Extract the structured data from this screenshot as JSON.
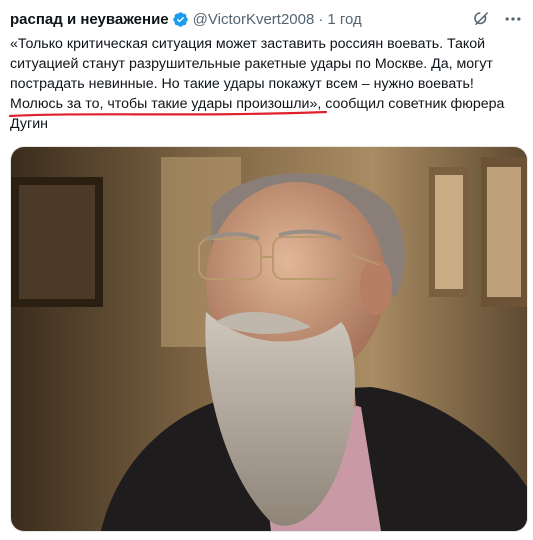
{
  "tweet": {
    "author_name": "распад и неуважение",
    "handle": "@VictorKvert2008",
    "separator": "·",
    "time": "1 год",
    "text": "«Только критическая ситуация может заставить россиян воевать. Такой\nситуацией станут разрушительные ракетные удары по Москве. Да, могут\nпострадать невинные. Но такие удары покажут всем – нужно воевать!\nМолюсь за то, чтобы такие удары произошли», сообщил советник фюрера\nДугин"
  },
  "icons": {
    "verified": "verified-badge-icon",
    "grok": "grok-icon",
    "more": "more-icon"
  },
  "colors": {
    "verified": "#1d9bf0",
    "text": "#0f1419",
    "secondary": "#536471",
    "annotation": "#e0212b"
  }
}
